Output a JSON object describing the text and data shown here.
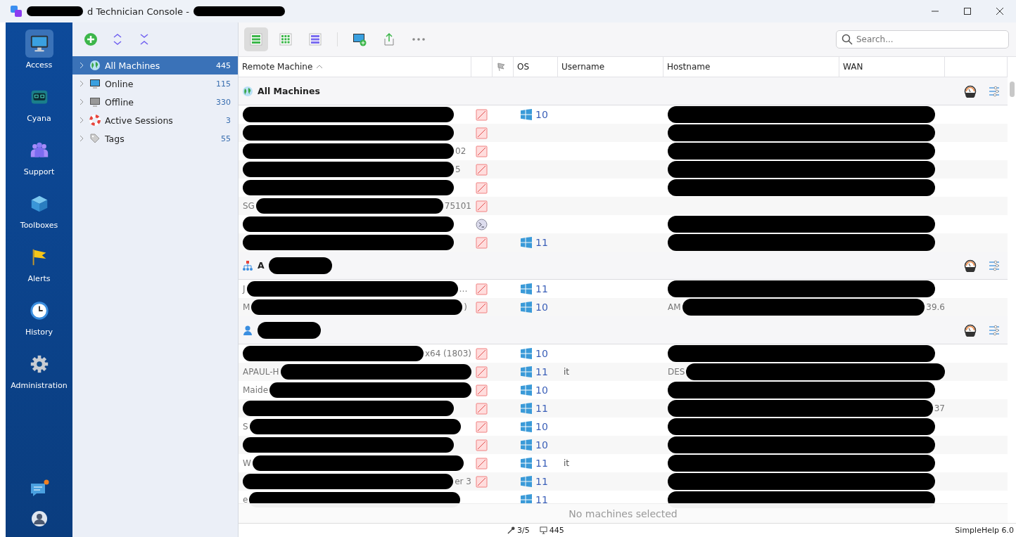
{
  "window": {
    "title_redacted_before": true,
    "title": "d Technician Console -",
    "title_redacted_after": true
  },
  "nav": [
    {
      "label": "Access",
      "selected": true
    },
    {
      "label": "Cyana",
      "selected": false
    },
    {
      "label": "Support",
      "selected": false
    },
    {
      "label": "Toolboxes",
      "selected": false
    },
    {
      "label": "Alerts",
      "selected": false
    },
    {
      "label": "History",
      "selected": false
    },
    {
      "label": "Administration",
      "selected": false
    }
  ],
  "nav_bottom": {
    "chat_unread": true
  },
  "tree": [
    {
      "label": "All Machines",
      "count": "445",
      "selected": true
    },
    {
      "label": "Online",
      "count": "115",
      "selected": false
    },
    {
      "label": "Offline",
      "count": "330",
      "selected": false
    },
    {
      "label": "Active Sessions",
      "count": "3",
      "selected": false
    },
    {
      "label": "Tags",
      "count": "55",
      "selected": false
    }
  ],
  "search": {
    "placeholder": "Search..."
  },
  "columns": [
    {
      "label": "Remote Machine",
      "sorted": true
    },
    {
      "kind": "status"
    },
    {
      "kind": "flag"
    },
    {
      "label": "OS"
    },
    {
      "label": "Username"
    },
    {
      "label": "Hostname"
    },
    {
      "label": "WAN"
    }
  ],
  "groups": [
    {
      "name": "All Machines",
      "name_redacted": false,
      "rows": [
        {
          "machine_redacted": true,
          "kind": "blocked",
          "os": "10",
          "host_redacted": true
        },
        {
          "machine_redacted": true,
          "kind": "blocked",
          "host_redacted": true
        },
        {
          "machine_redacted": true,
          "machine_end": "02",
          "kind": "blocked",
          "host_redacted": true
        },
        {
          "machine_redacted": true,
          "machine_end": "5",
          "kind": "blocked",
          "host_redacted": true
        },
        {
          "machine_redacted": true,
          "kind": "blocked",
          "host_redacted": true
        },
        {
          "machine_start": "SG",
          "machine_redacted": true,
          "machine_end": "75101",
          "kind": "blocked",
          "host_redacted": false
        },
        {
          "machine_redacted": true,
          "kind": "console",
          "host_redacted": true
        },
        {
          "machine_redacted": true,
          "kind": "blocked",
          "os": "11",
          "host_redacted": true
        }
      ]
    },
    {
      "name": "A",
      "name_redacted": true,
      "rows": [
        {
          "machine_start": "J",
          "machine_redacted": true,
          "machine_end": "…",
          "kind": "blocked",
          "os": "11",
          "host_redacted": true
        },
        {
          "machine_start": "M",
          "machine_redacted": true,
          "machine_end": ")",
          "kind": "blocked",
          "os": "10",
          "host_start": "AM",
          "host_redacted": true,
          "host_end": "39.6"
        }
      ]
    },
    {
      "name_redacted": true,
      "rows": [
        {
          "machine_redacted": true,
          "machine_end": "x64 (1803)",
          "kind": "blocked",
          "os": "10",
          "host_redacted": true
        },
        {
          "machine_start": "APAUL-H",
          "machine_redacted": true,
          "kind": "blocked",
          "os": "11",
          "username": "it",
          "host_start": "DES",
          "host_redacted": true
        },
        {
          "machine_start": "Maide",
          "machine_redacted": true,
          "kind": "blocked",
          "os": "10",
          "host_redacted": true
        },
        {
          "machine_redacted": true,
          "kind": "blocked",
          "os": "11",
          "host_redacted": true,
          "host_end": "37"
        },
        {
          "machine_start": "S",
          "machine_redacted": true,
          "kind": "blocked",
          "os": "10",
          "host_redacted": true
        },
        {
          "machine_redacted": true,
          "kind": "blocked",
          "os": "10",
          "host_redacted": true
        },
        {
          "machine_start": "W",
          "machine_redacted": true,
          "kind": "blocked",
          "os": "11",
          "username": "it",
          "host_redacted": true
        },
        {
          "machine_redacted": true,
          "machine_end": "er 3",
          "kind": "blocked",
          "os": "11",
          "host_redacted": true
        },
        {
          "machine_start": "e",
          "machine_redacted": true,
          "kind": "none",
          "os": "11",
          "host_redacted": true
        }
      ]
    }
  ],
  "selection_note": "No machines selected",
  "status_bar": {
    "licenses": "3/5",
    "machines": "445",
    "version": "SimpleHelp 6.0"
  }
}
